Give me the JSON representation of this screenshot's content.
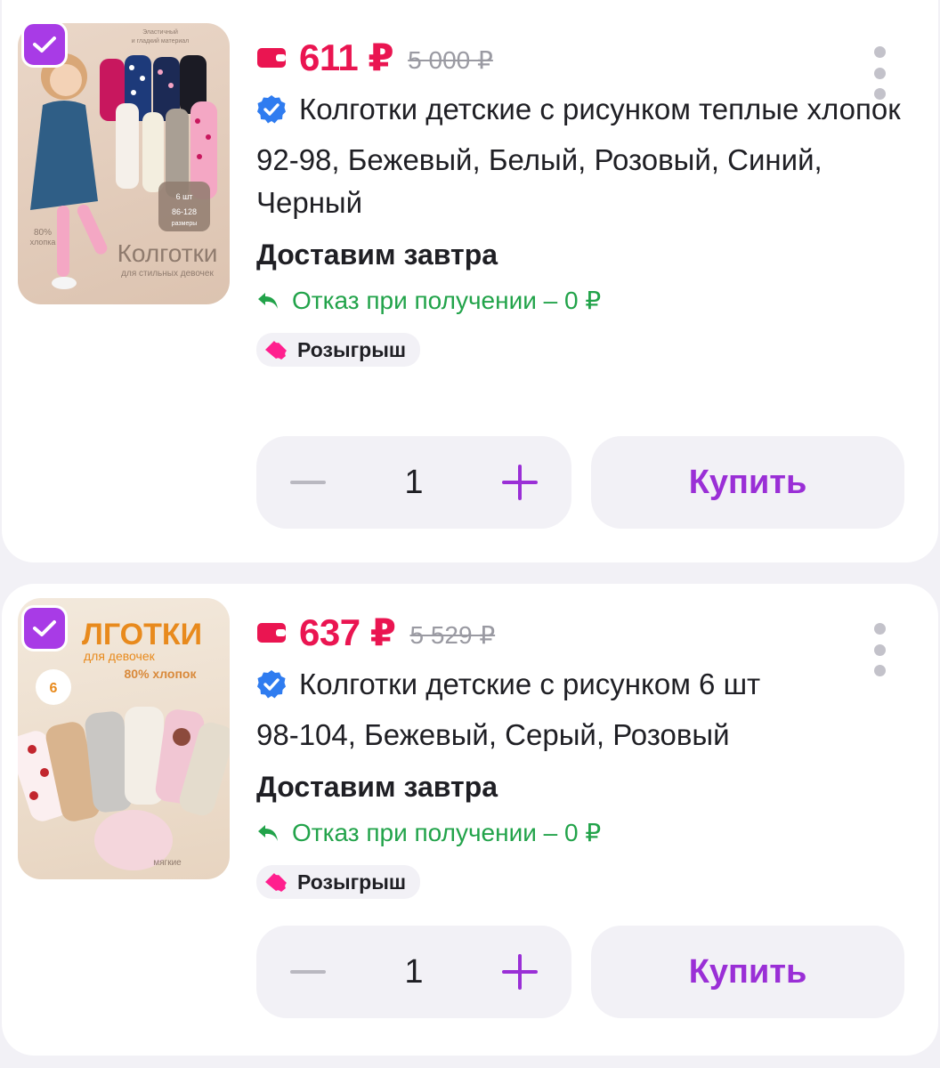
{
  "products": [
    {
      "price": "611 ₽",
      "old_price": "5 000 ₽",
      "title": "Колготки детские с рисунком теплые хлопок",
      "variants": "92-98, Бежевый, Белый, Розовый, Синий, Черный",
      "delivery": "Доставим завтра",
      "refusal": "Отказ при получении – 0 ₽",
      "badge": "Розыгрыш",
      "quantity": "1",
      "buy_label": "Купить",
      "image_text": {
        "top_note": "Эластичный и гладкий материал",
        "pack": "6 шт",
        "sizes": "86-128 размеры",
        "cotton": "80% хлопка",
        "headline": "Колготки",
        "subline": "для стильных девочек"
      }
    },
    {
      "price": "637 ₽",
      "old_price": "5 529 ₽",
      "title": "Колготки детские с рисунком 6 шт",
      "variants": "98-104, Бежевый, Серый, Розовый",
      "delivery": "Доставим завтра",
      "refusal": "Отказ при получении – 0 ₽",
      "badge": "Розыгрыш",
      "quantity": "1",
      "buy_label": "Купить",
      "image_text": {
        "headline": "ЛГОТКИ",
        "subline": "для девочек",
        "cotton": "80% хлопок",
        "pack": "6 пар",
        "soft": "мягкие"
      }
    }
  ],
  "colors": {
    "price": "#ea1551",
    "accent": "#9a2fd6",
    "checkbox": "#a83be6",
    "success": "#22a34a",
    "verified": "#2f7cf0"
  },
  "icons": [
    "checkbox-checked-icon",
    "wallet-icon",
    "verified-icon",
    "return-arrow-icon",
    "ticket-icon",
    "more-vertical-icon",
    "minus-icon",
    "plus-icon"
  ]
}
